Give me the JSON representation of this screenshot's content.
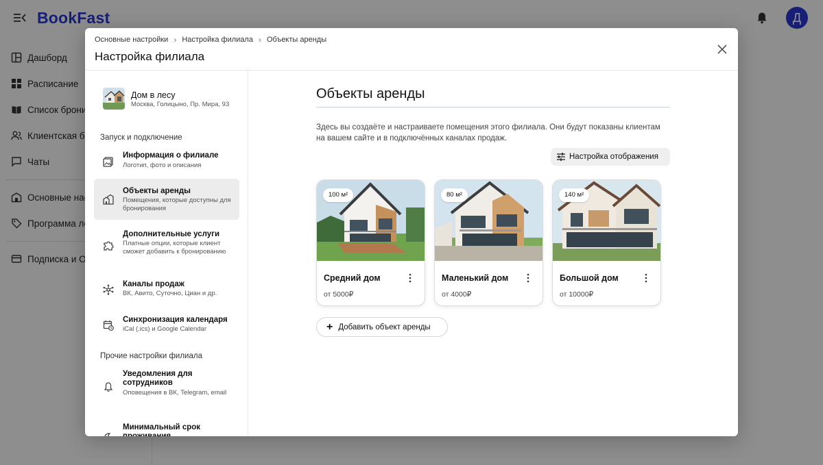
{
  "app": {
    "logo_text": "BookFast",
    "avatar_initial": "Д",
    "nav": [
      {
        "label": "Дашборд",
        "icon": "dashboard-icon"
      },
      {
        "label": "Расписание",
        "icon": "grid-icon"
      },
      {
        "label": "Список брони",
        "icon": "book-icon"
      },
      {
        "label": "Клиентская база",
        "icon": "users-icon"
      },
      {
        "label": "Чаты",
        "icon": "chat-icon"
      },
      {
        "label": "Основные настройки",
        "icon": "building-icon"
      },
      {
        "label": "Программа лояльности",
        "icon": "tag-icon"
      },
      {
        "label": "Подписка и Оплата",
        "icon": "card-icon"
      }
    ]
  },
  "modal": {
    "breadcrumb": [
      "Основные настройки",
      "Настройка филиала",
      "Объекты аренды"
    ],
    "title": "Настройка филиала",
    "branch": {
      "name": "Дом в лесу",
      "address": "Москва, Голицыно, Пр. Мира, 93"
    },
    "sections": {
      "launch": "Запуск и подключение",
      "other": "Прочие настройки филиала"
    },
    "menu": [
      {
        "title": "Информация о филиале",
        "desc": "Логотип, фото и описания",
        "icon": "image-icon"
      },
      {
        "title": "Объекты аренды",
        "desc": "Помещения, которые доступны для бронирования",
        "icon": "houses-icon"
      },
      {
        "title": "Дополнительные услуги",
        "desc": "Платные опции, которые клиент сможет добавить к бронированию",
        "icon": "puzzle-icon"
      },
      {
        "title": "Каналы продаж",
        "desc": "ВК, Авито, Суточно, Циан и др.",
        "icon": "network-icon"
      },
      {
        "title": "Синхронизация календаря",
        "desc": "iCal (.ics) и Google Calendar",
        "icon": "calendar-sync-icon"
      },
      {
        "title": "Уведомления для сотрудников",
        "desc": "Оповещения в ВК, Telegram, email",
        "icon": "bell-icon"
      },
      {
        "title": "Минимальный срок проживания",
        "desc": "",
        "icon": "moon-icon"
      }
    ],
    "content": {
      "title": "Объекты аренды",
      "description": "Здесь вы создаёте и настраиваете помещения этого филиала. Они будут показаны клиентам на вашем сайте и в подключённых каналах продаж.",
      "display_button": "Настройка отображения",
      "add_button": "Добавить объект аренды",
      "objects": [
        {
          "name": "Средний дом",
          "area": "100 м²",
          "price": "от 5000₽"
        },
        {
          "name": "Маленький дом",
          "area": "80 м²",
          "price": "от 4000₽"
        },
        {
          "name": "Большой дом",
          "area": "140 м²",
          "price": "от 10000₽"
        }
      ]
    }
  }
}
